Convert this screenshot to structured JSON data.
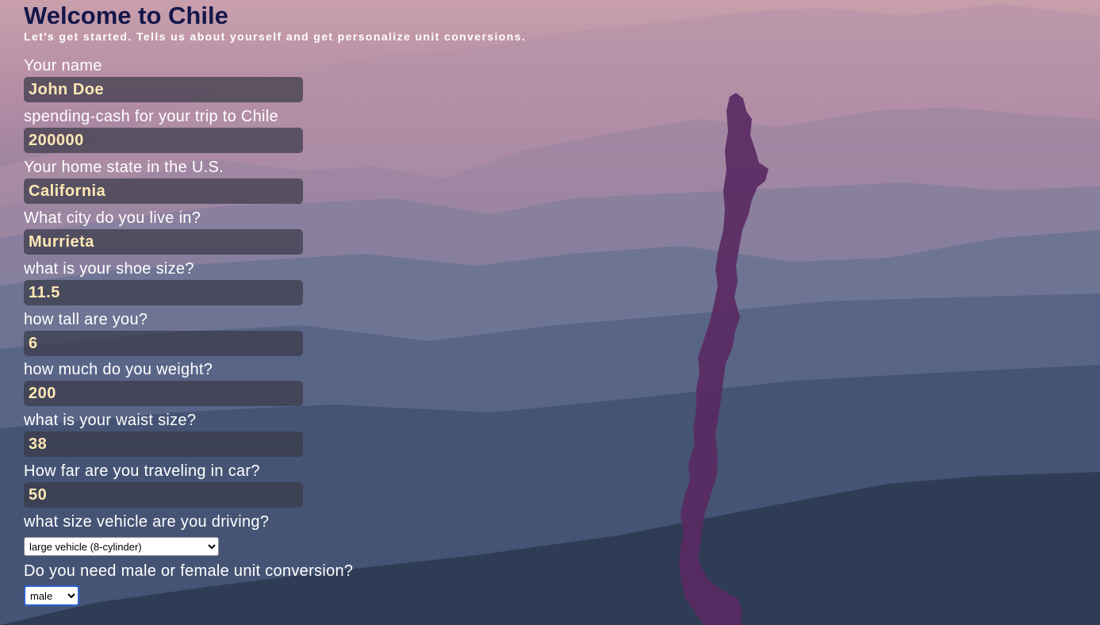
{
  "header": {
    "title": "Welcome to Chile",
    "subtitle": "Let's get started. Tells us about yourself and get personalize unit conversions."
  },
  "form": {
    "fields": [
      {
        "label": "Your name",
        "value": "John Doe"
      },
      {
        "label": "spending-cash for your trip to Chile",
        "value": "200000"
      },
      {
        "label": "Your home state in the U.S.",
        "value": "California"
      },
      {
        "label": "What city do you live in?",
        "value": "Murrieta"
      },
      {
        "label": "what is your shoe size?",
        "value": "11.5"
      },
      {
        "label": "how tall are you?",
        "value": "6"
      },
      {
        "label": "how much do you weight?",
        "value": "200"
      },
      {
        "label": "what is your waist size?",
        "value": "38"
      },
      {
        "label": "How far are you traveling in car?",
        "value": "50"
      }
    ],
    "vehicle": {
      "label": "what size vehicle are you driving?",
      "selected": "large vehicle (8-cylinder)"
    },
    "sex": {
      "label": "Do you need male or female unit conversion?",
      "selected": "male"
    }
  },
  "colors": {
    "title": "#14174a",
    "input_text": "#ffe7b5",
    "input_bg": "#3a3a48",
    "map_fill": "#5a2a63"
  },
  "background": {
    "icons": [
      "mountain-range-background",
      "chile-map-silhouette"
    ]
  }
}
